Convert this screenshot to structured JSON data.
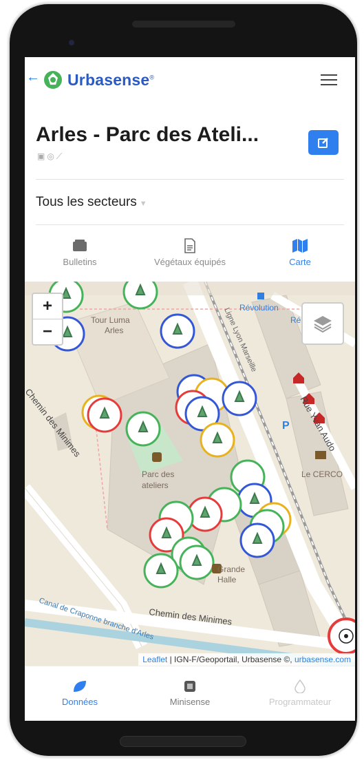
{
  "header": {
    "back_icon": "arrow-left-icon",
    "brand": "Urbasense",
    "brand_mark": "®",
    "menu_icon": "hamburger-icon",
    "accent": "#2f80ee"
  },
  "page": {
    "title": "Arles - Parc des Ateli...",
    "title_icons": "▣◎⟋",
    "edit_icon": "edit-icon"
  },
  "sector": {
    "label": "Tous les secteurs",
    "caret": "▼"
  },
  "tabs": [
    {
      "label": "Bulletins",
      "icon": "folder-icon"
    },
    {
      "label": "Végétaux équipés",
      "icon": "document-icon"
    },
    {
      "label": "Carte",
      "icon": "map-icon",
      "active": true
    }
  ],
  "map": {
    "zoom_in": "+",
    "zoom_out": "−",
    "labels": {
      "tour": "Tour Luma",
      "tour2": "Arles",
      "park": "Parc des",
      "park2": "ateliers",
      "halle": "Grande",
      "halle2": "Halle",
      "cerco": "Le CERCO",
      "revolution": "Révolution",
      "re": "Ré",
      "street1": "Chemin des Minimes",
      "street2": "Chemin des Minimes",
      "street3": "Rue Yvan Audo",
      "rail": "Ligne Lyon Marseille",
      "canal": "Canal de Craponne branche d'Arles",
      "parking": "P"
    },
    "attribution_leaflet": "Leaflet",
    "attribution_text": " | IGN-F/Geoportail, Urbasense ©, ",
    "attribution_link": "urbasense.com",
    "sensor_colors": {
      "green": "#46b35a",
      "blue": "#3457d5",
      "red": "#e53b3b",
      "yellow": "#e8b21e"
    }
  },
  "bottom_nav": [
    {
      "label": "Données",
      "icon": "leaf-icon",
      "state": "active"
    },
    {
      "label": "Minisense",
      "icon": "chip-icon",
      "state": "normal"
    },
    {
      "label": "Programmateur",
      "icon": "drop-icon",
      "state": "disabled"
    }
  ]
}
